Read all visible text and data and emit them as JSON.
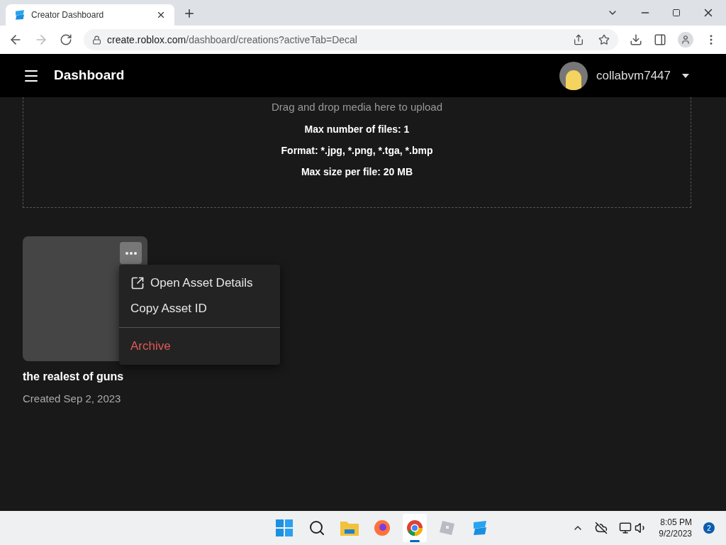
{
  "browser": {
    "tab_title": "Creator Dashboard",
    "url_host": "create.roblox.com",
    "url_path": "/dashboard/creations?activeTab=Decal"
  },
  "header": {
    "title": "Dashboard",
    "username": "collabvm7447"
  },
  "upload": {
    "hint": "Drag and drop media here to upload",
    "rules": [
      "Max number of files: 1",
      "Format: *.jpg, *.png, *.tga, *.bmp",
      "Max size per file: 20 MB"
    ]
  },
  "asset": {
    "name": "the realest of guns",
    "created": "Created Sep 2, 2023"
  },
  "menu": [
    {
      "label": "Open Asset Details",
      "kind": "link"
    },
    {
      "label": "Copy Asset ID",
      "kind": "plain"
    },
    {
      "label": "Archive",
      "kind": "danger"
    }
  ],
  "taskbar": {
    "apps": [
      {
        "kind": "start",
        "selected": false
      },
      {
        "kind": "search",
        "selected": false
      },
      {
        "kind": "files",
        "selected": false
      },
      {
        "kind": "firefox",
        "selected": false
      },
      {
        "kind": "chrome",
        "selected": true
      },
      {
        "kind": "roblox",
        "selected": false
      },
      {
        "kind": "studio",
        "selected": false
      }
    ],
    "time": "8:05 PM",
    "date": "9/2/2023",
    "badge": "2"
  }
}
